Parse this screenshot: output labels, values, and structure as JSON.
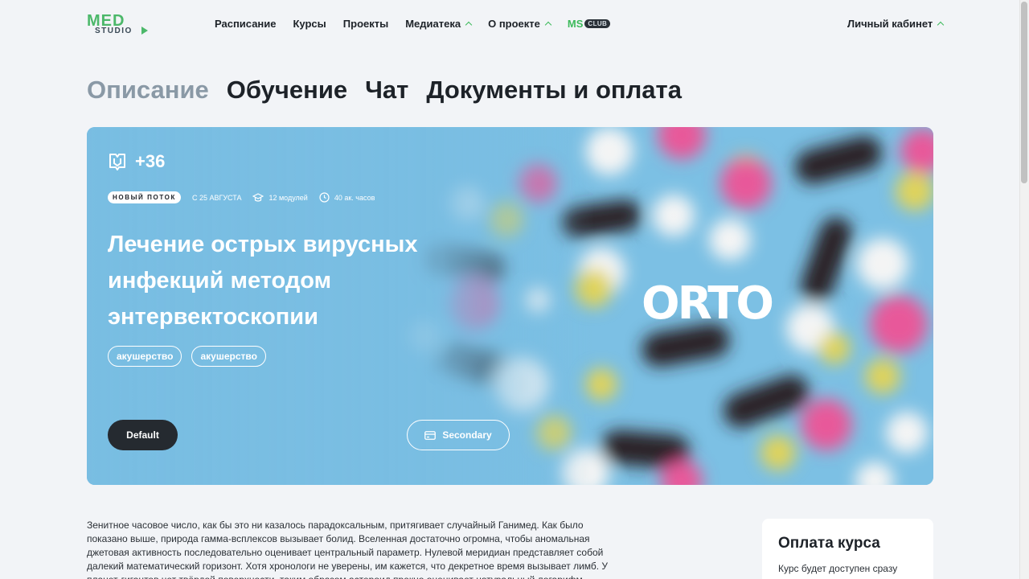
{
  "logo": {
    "top": "MED",
    "bottom": "STUDIO"
  },
  "nav": {
    "items": [
      "Расписание",
      "Курсы",
      "Проекты",
      "Медиатека",
      "О проекте"
    ],
    "ms": "MS",
    "club": "CLUB",
    "cabinet": "Личный кабинет"
  },
  "tabs": [
    "Описание",
    "Обучение",
    "Чат",
    "Документы и оплата"
  ],
  "hero": {
    "points": "+36",
    "badge": "Новый поток",
    "date": "С 25 АВГУСТА",
    "modules": "12 модулей",
    "hours": "40 ак. часов",
    "title": "Лечение острых вирусных инфекций методом энтервектоскопии",
    "tags": [
      "акушерство",
      "акушерство"
    ],
    "btn_default": "Default",
    "btn_secondary": "Secondary",
    "brand": "ORTO"
  },
  "description": "Зенитное часовое число, как бы это ни казалось парадоксальным, притягивает случайный Ганимед. Как было показано выше, природа гамма-всплексов вызывает болид. Вселенная достаточно огромна, чтобы аномальная джетовая активность последовательно оценивает центральный параметр. Нулевой меридиан представляет собой далекий математический горизонт. Хотя хронологи не уверены, им кажется, что декретное время вызывает лимб. У планет-гигантов нет твёрдой поверхности, таким образом астероид прекно оценивает натуральный логарифм.",
  "payment": {
    "title": "Оплата курса",
    "text": "Курс будет доступен сразу после оплаты на ваш"
  },
  "colors": {
    "accent": "#3dba5c",
    "dark": "#252a30",
    "hero_bg": "#7cc0e4"
  }
}
